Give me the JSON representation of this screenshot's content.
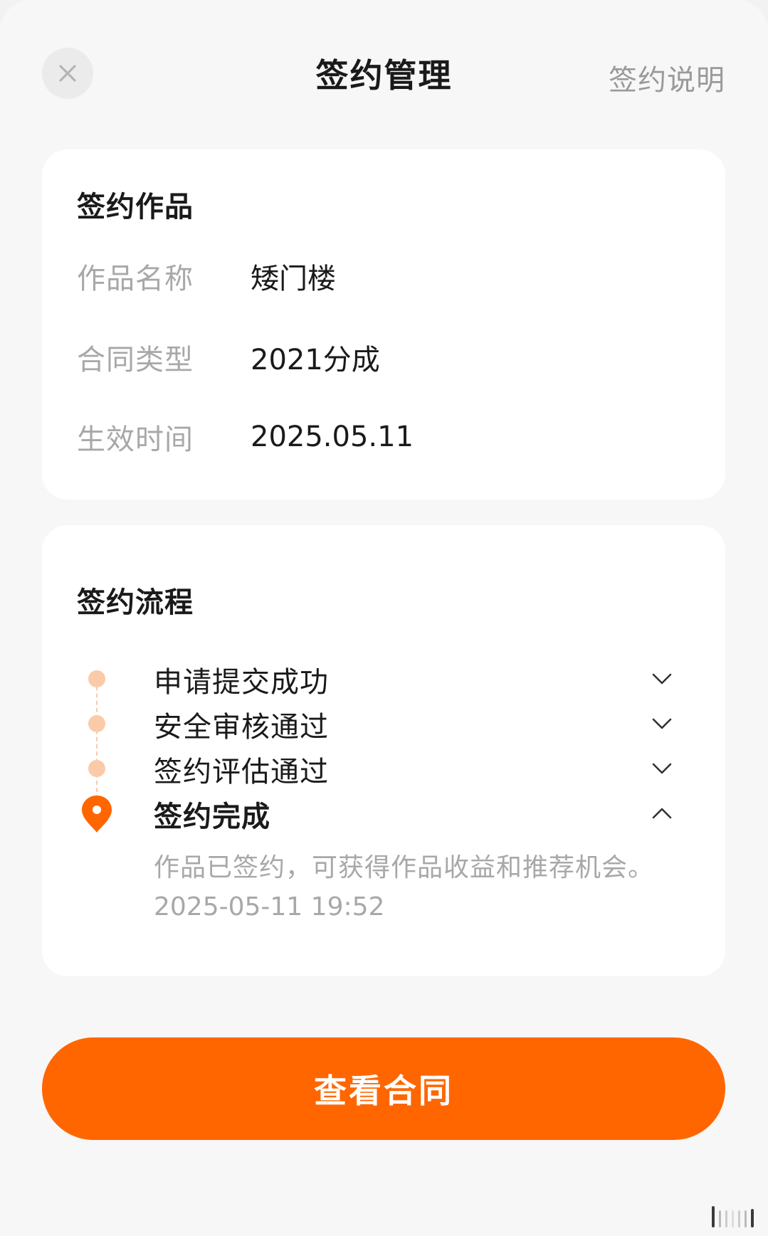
{
  "header": {
    "title": "签约管理",
    "help_label": "签约说明",
    "close_icon": "close-icon"
  },
  "work_card": {
    "title": "签约作品",
    "rows": [
      {
        "label": "作品名称",
        "value": "矮门楼"
      },
      {
        "label": "合同类型",
        "value": "2021分成"
      },
      {
        "label": "生效时间",
        "value": "2025.05.11"
      }
    ]
  },
  "flow_card": {
    "title": "签约流程",
    "steps": [
      {
        "label": "申请提交成功",
        "state": "done",
        "expanded": false
      },
      {
        "label": "安全审核通过",
        "state": "done",
        "expanded": false
      },
      {
        "label": "签约评估通过",
        "state": "done",
        "expanded": false
      },
      {
        "label": "签约完成",
        "state": "current",
        "expanded": true
      }
    ],
    "current_desc": "作品已签约，可获得作品收益和推荐机会。",
    "current_time": "2025-05-11 19:52"
  },
  "cta": {
    "label": "查看合同"
  },
  "colors": {
    "accent": "#ff6600",
    "dot_done": "#fbcaa8",
    "label_gray": "#a8a8a8"
  }
}
